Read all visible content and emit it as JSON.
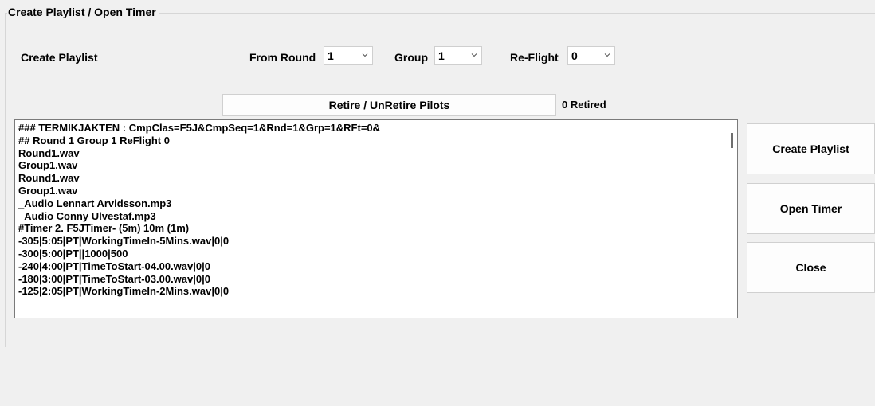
{
  "group": {
    "title": "Create Playlist / Open Timer"
  },
  "create_playlist_label": "Create Playlist",
  "from_round": {
    "label": "From Round",
    "value": "1"
  },
  "group_select": {
    "label": "Group",
    "value": "1"
  },
  "reflight": {
    "label": "Re-Flight",
    "value": "0"
  },
  "retire_button": "Retire / UnRetire Pilots",
  "retired_count": "0 Retired",
  "playlist_lines": [
    "### TERMIKJAKTEN : CmpClas=F5J&CmpSeq=1&Rnd=1&Grp=1&RFt=0&",
    "## Round 1   Group 1   ReFlight 0",
    "Round1.wav",
    "Group1.wav",
    "Round1.wav",
    "Group1.wav",
    "_Audio Lennart Arvidsson.mp3",
    "_Audio Conny Ulvestaf.mp3",
    "#Timer 2. F5JTimer- (5m) 10m (1m)",
    "-305|5:05|PT|WorkingTimeIn-5Mins.wav|0|0",
    "-300|5:00|PT||1000|500",
    "-240|4:00|PT|TimeToStart-04.00.wav|0|0",
    "-180|3:00|PT|TimeToStart-03.00.wav|0|0",
    "-125|2:05|PT|WorkingTimeIn-2Mins.wav|0|0"
  ],
  "buttons": {
    "create_playlist": "Create Playlist",
    "open_timer": "Open Timer",
    "close": "Close"
  },
  "colors": {
    "highlight": "#fff200"
  }
}
